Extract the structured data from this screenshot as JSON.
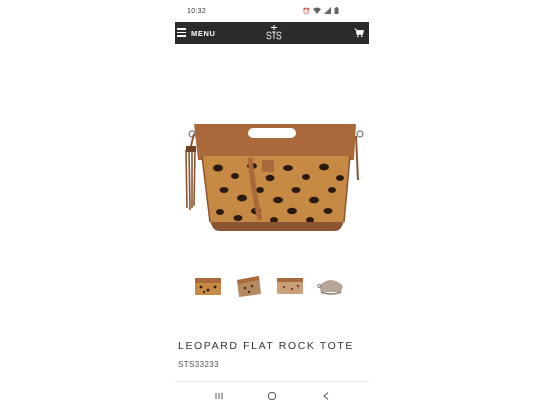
{
  "status_bar": {
    "time": "10:32"
  },
  "header": {
    "menu_label": "MENU",
    "logo_text": "STS",
    "background": "#2b2b2b"
  },
  "product": {
    "title": "LEOPARD FLAT ROCK TOTE",
    "sku": "STS33233",
    "image_icon": "leopard-tote-bag",
    "thumbnails": [
      {
        "name": "thumb-front"
      },
      {
        "name": "thumb-angle"
      },
      {
        "name": "thumb-back"
      },
      {
        "name": "thumb-side"
      }
    ]
  },
  "colors": {
    "leather": "#a9693a",
    "leopard": "#c78a45",
    "spots": "#2a1a10"
  }
}
